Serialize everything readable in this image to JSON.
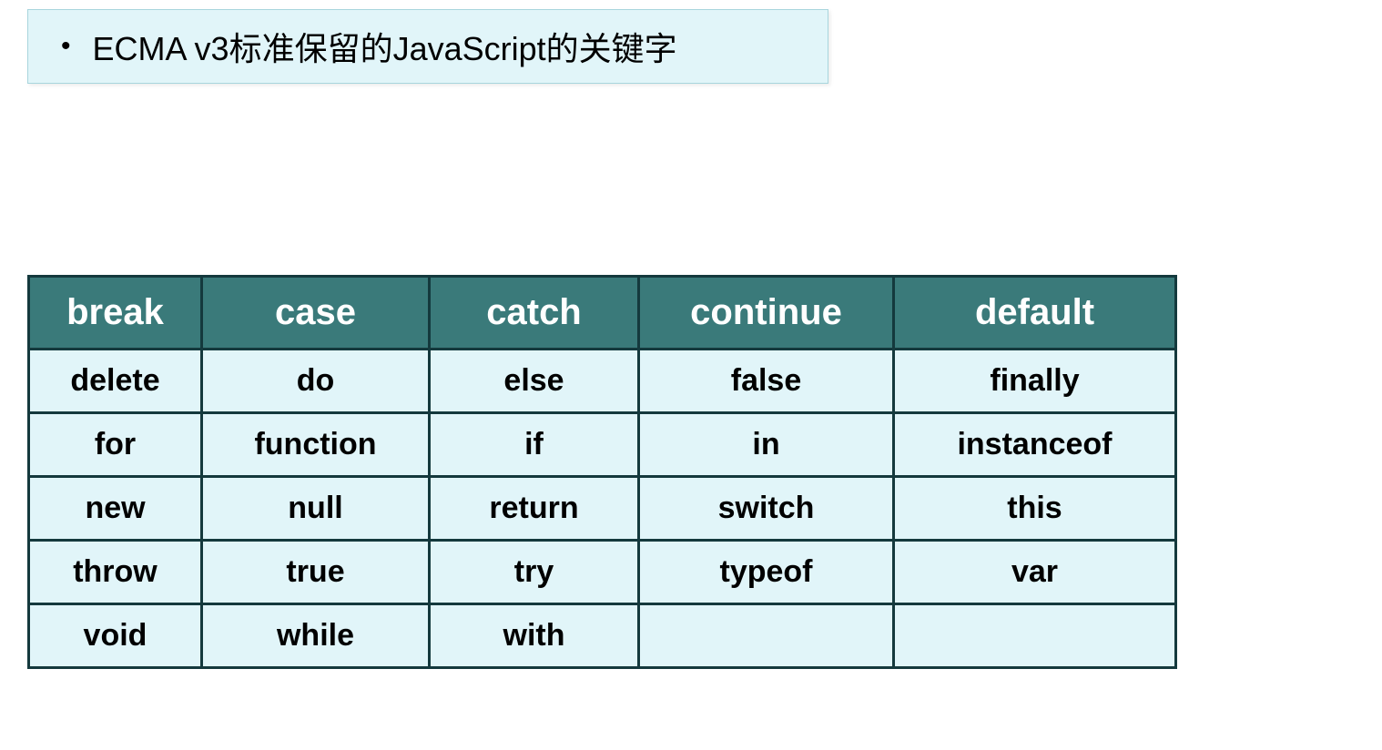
{
  "title": "ECMA v3标准保留的JavaScript的关键字",
  "table": {
    "header": [
      "break",
      "case",
      "catch",
      "continue",
      "default"
    ],
    "rows": [
      [
        "delete",
        "do",
        "else",
        "false",
        "finally"
      ],
      [
        "for",
        "function",
        "if",
        "in",
        "instanceof"
      ],
      [
        "new",
        "null",
        "return",
        "switch",
        "this"
      ],
      [
        "throw",
        "true",
        "try",
        "typeof",
        "var"
      ],
      [
        "void",
        "while",
        "with",
        "",
        ""
      ]
    ]
  }
}
